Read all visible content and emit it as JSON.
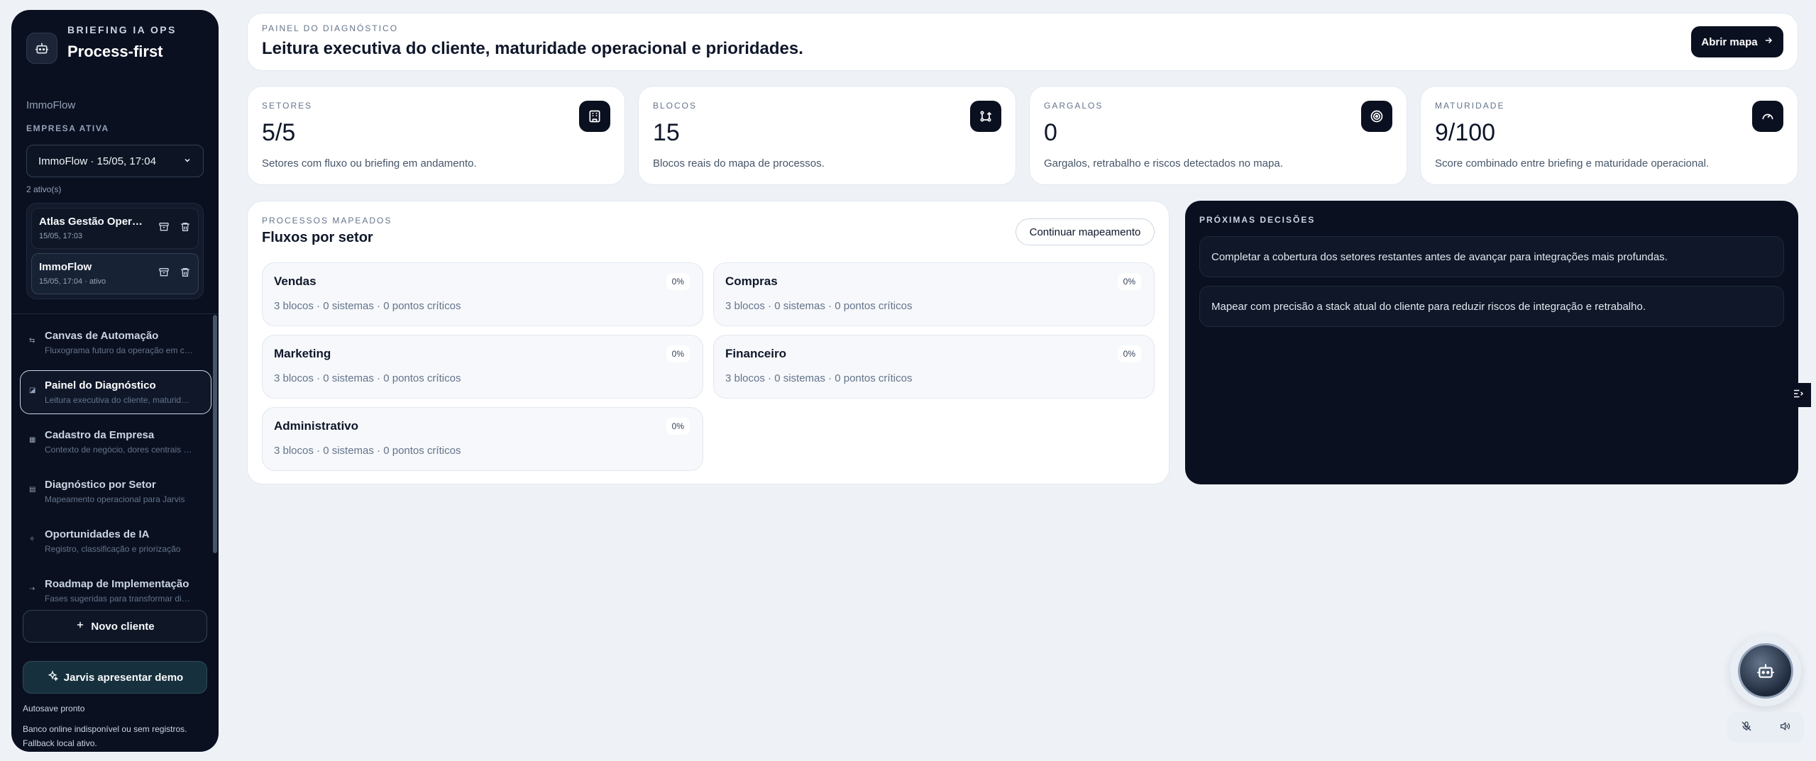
{
  "sidebar": {
    "kicker": "BRIEFING IA OPS",
    "title": "Process-first",
    "active_company_name": "ImmoFlow",
    "active_label": "EMPRESA ATIVA",
    "company_select_value": "ImmoFlow · 15/05, 17:04",
    "active_count": "2 ativo(s)",
    "clients": [
      {
        "name": "Atlas Gestão Operacional",
        "meta": "15/05, 17:03"
      },
      {
        "name": "ImmoFlow",
        "meta": "15/05, 17:04 · ativo"
      }
    ],
    "nav": [
      {
        "title": "Canvas de Automação",
        "sub": "Fluxograma futuro da operação em camadas"
      },
      {
        "title": "Painel do Diagnóstico",
        "sub": "Leitura executiva do cliente, maturidade e prioridades"
      },
      {
        "title": "Cadastro da Empresa",
        "sub": "Contexto de negócio, dores centrais e objetivos"
      },
      {
        "title": "Diagnóstico por Setor",
        "sub": "Mapeamento operacional para Jarvis"
      },
      {
        "title": "Oportunidades de IA",
        "sub": "Registro, classificação e priorização"
      },
      {
        "title": "Roadmap de Implementação",
        "sub": "Fases sugeridas para transformar diagnóstico"
      }
    ],
    "new_client_label": "Novo cliente",
    "demo_label": "Jarvis apresentar demo",
    "autosave": "Autosave pronto",
    "fallback": "Banco online indisponível ou sem registros. Fallback local ativo."
  },
  "header": {
    "kicker": "PAINEL DO DIAGNÓSTICO",
    "title": "Leitura executiva do cliente, maturidade operacional e prioridades.",
    "map_button": "Abrir mapa"
  },
  "stats": [
    {
      "kicker": "SETORES",
      "value": "5/5",
      "desc": "Setores com fluxo ou briefing em andamento.",
      "icon": "building-icon"
    },
    {
      "kicker": "BLOCOS",
      "value": "15",
      "desc": "Blocos reais do mapa de processos.",
      "icon": "git-branch-icon"
    },
    {
      "kicker": "GARGALOS",
      "value": "0",
      "desc": "Gargalos, retrabalho e riscos detectados no mapa.",
      "icon": "target-icon"
    },
    {
      "kicker": "MATURIDADE",
      "value": "9/100",
      "desc": "Score combinado entre briefing e maturidade operacional.",
      "icon": "gauge-icon"
    }
  ],
  "processes": {
    "kicker": "PROCESSOS MAPEADOS",
    "title": "Fluxos por setor",
    "continue_button": "Continuar mapeamento",
    "sectors": [
      {
        "name": "Vendas",
        "meta": "3 blocos · 0 sistemas · 0 pontos críticos",
        "pct": "0%"
      },
      {
        "name": "Compras",
        "meta": "3 blocos · 0 sistemas · 0 pontos críticos",
        "pct": "0%"
      },
      {
        "name": "Marketing",
        "meta": "3 blocos · 0 sistemas · 0 pontos críticos",
        "pct": "0%"
      },
      {
        "name": "Financeiro",
        "meta": "3 blocos · 0 sistemas · 0 pontos críticos",
        "pct": "0%"
      },
      {
        "name": "Administrativo",
        "meta": "3 blocos · 0 sistemas · 0 pontos críticos",
        "pct": "0%"
      }
    ]
  },
  "decisions": {
    "kicker": "PRÓXIMAS DECISÕES",
    "items": [
      "Completar a cobertura dos setores restantes antes de avançar para integrações mais profundas.",
      "Mapear com precisão a stack atual do cliente para reduzir riscos de integração e retrabalho."
    ]
  },
  "colors": {
    "sidebar_bg": "#0a1020",
    "page_bg": "#eef2f7",
    "accent_dark": "#0b1020",
    "card_bg": "#ffffff"
  }
}
